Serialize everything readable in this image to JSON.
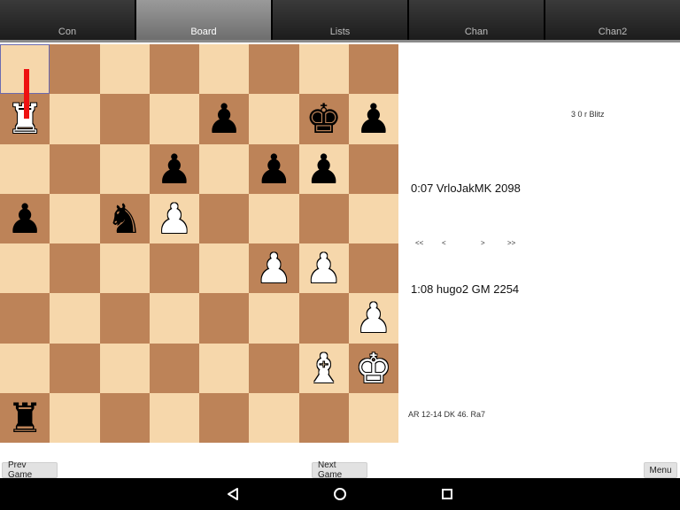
{
  "tabs": [
    "Con",
    "Board",
    "Lists",
    "Chan",
    "Chan2"
  ],
  "active_tab": 1,
  "board": {
    "light_color": "#f6d7ab",
    "dark_color": "#bd8358",
    "highlight_color": "#6b6bb0",
    "arrow_color": "#ee1111",
    "rows": [
      [
        "",
        "",
        "",
        "",
        "",
        "",
        "",
        ""
      ],
      [
        "wr",
        "",
        "",
        "",
        "bp",
        "",
        "bk",
        "bp"
      ],
      [
        "",
        "",
        "",
        "bp",
        "",
        "bp",
        "bp",
        ""
      ],
      [
        "bp",
        "",
        "bn",
        "wp",
        "",
        "",
        "",
        ""
      ],
      [
        "",
        "",
        "",
        "",
        "",
        "wp",
        "wp",
        ""
      ],
      [
        "",
        "",
        "",
        "",
        "",
        "",
        "",
        "wp"
      ],
      [
        "",
        "",
        "",
        "",
        "",
        "",
        "wb",
        "wk"
      ],
      [
        "br",
        "",
        "",
        "",
        "",
        "",
        "",
        ""
      ]
    ]
  },
  "game": {
    "type": "3 0 r Blitz",
    "top_player": "0:07  VrloJakMK  2098",
    "bottom_player": "1:08  hugo2 GM 2254",
    "last_move": "AR 12-14 DK 46. Ra7"
  },
  "nav": {
    "first": "<<",
    "prev": "<",
    "next": ">",
    "last": ">>"
  },
  "buttons": {
    "prev_game": "Prev Game",
    "next_game": "Next Game",
    "menu": "Menu"
  },
  "system_nav": {
    "back": "back-icon",
    "home": "home-icon",
    "recents": "recents-icon"
  }
}
